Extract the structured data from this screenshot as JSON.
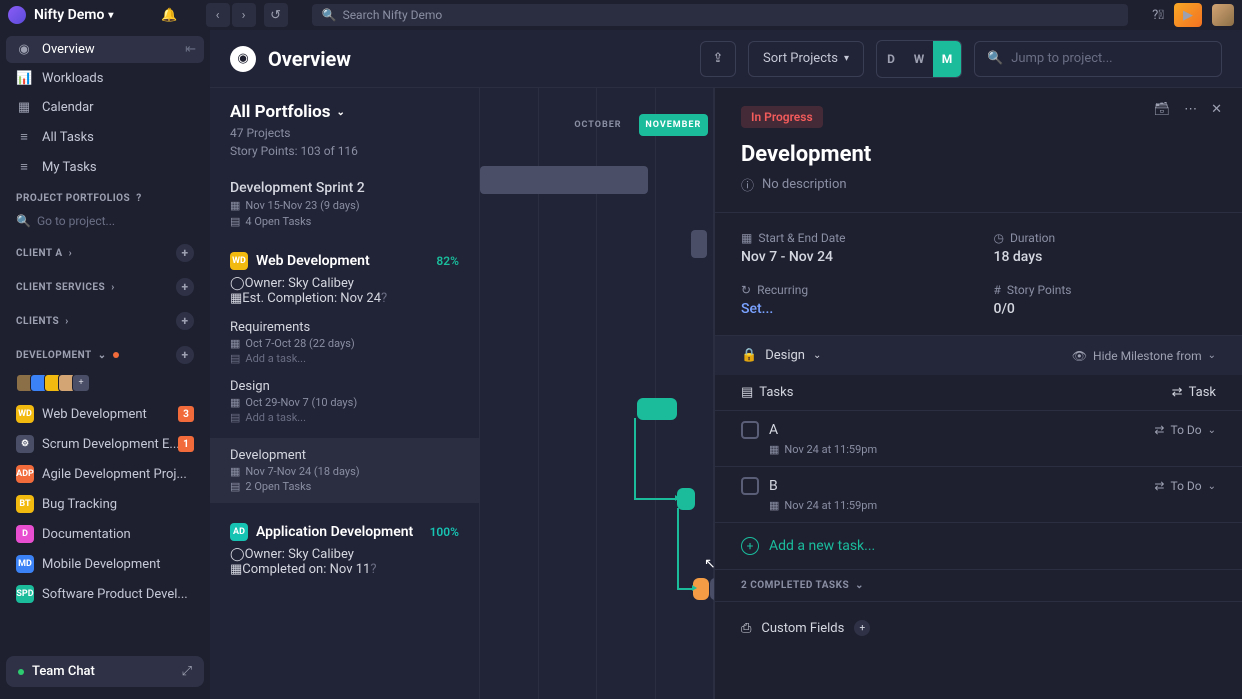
{
  "topbar": {
    "workspace": "Nifty Demo",
    "search_placeholder": "Search Nifty Demo"
  },
  "sidebar": {
    "nav": [
      {
        "icon": "◉",
        "label": "Overview",
        "active": true
      },
      {
        "icon": "⫿",
        "label": "Workloads"
      },
      {
        "icon": "▦",
        "label": "Calendar"
      },
      {
        "icon": "≡",
        "label": "All Tasks"
      },
      {
        "icon": "≡",
        "label": "My Tasks"
      }
    ],
    "portfolios_header": "PROJECT PORTFOLIOS",
    "goto_placeholder": "Go to project...",
    "sections": [
      {
        "name": "CLIENT A"
      },
      {
        "name": "CLIENT SERVICES"
      },
      {
        "name": "CLIENTS"
      }
    ],
    "dev_section": "DEVELOPMENT",
    "dev_projects": [
      {
        "badge": "WD",
        "color": "#f2b90f",
        "name": "Web Development",
        "count": "3"
      },
      {
        "badge": "⚙",
        "color": "#4a4e66",
        "name": "Scrum Development E...",
        "count": "1"
      },
      {
        "badge": "ADP",
        "color": "#f26b3a",
        "name": "Agile Development Proj..."
      },
      {
        "badge": "BT",
        "color": "#f2b90f",
        "name": "Bug Tracking"
      },
      {
        "badge": "D",
        "color": "#e84fd0",
        "name": "Documentation"
      },
      {
        "badge": "MD",
        "color": "#3b82f6",
        "name": "Mobile Development"
      },
      {
        "badge": "SPD",
        "color": "#1abc9c",
        "name": "Software Product Devel..."
      }
    ],
    "chat": "Team Chat"
  },
  "overview": {
    "title": "Overview",
    "sort": "Sort Projects",
    "jump_placeholder": "Jump to project...",
    "modes": [
      "D",
      "W",
      "M"
    ]
  },
  "portfolio": {
    "title": "All Portfolios",
    "projects": "47 Projects",
    "points": "Story Points: 103 of 116"
  },
  "months": [
    "OCTOBER",
    "NOVEMBER"
  ],
  "groups": [
    {
      "type": "sprint",
      "title": "Development Sprint 2",
      "date": "Nov 15-Nov 23 (9 days)",
      "open": "4 Open Tasks"
    },
    {
      "type": "project",
      "title": "Web Development",
      "badge": "WD",
      "badge_color": "#f2b90f",
      "pct": "82%",
      "owner": "Owner: Sky Calibey",
      "completion": "Est. Completion: Nov 24",
      "milestones": [
        {
          "name": "Requirements",
          "date": "Oct 7-Oct 28 (22 days)",
          "add": "Add a task..."
        },
        {
          "name": "Design",
          "date": "Oct 29-Nov 7 (10 days)",
          "add": "Add a task..."
        },
        {
          "name": "Development",
          "date": "Nov 7-Nov 24 (18 days)",
          "open": "2 Open Tasks",
          "selected": true
        }
      ]
    },
    {
      "type": "project",
      "title": "Application Development",
      "badge": "AD",
      "badge_color": "#17c3b2",
      "pct": "100%",
      "owner": "Owner: Sky Calibey",
      "completion": "Completed on: Nov 11"
    }
  ],
  "detail": {
    "status": "In Progress",
    "title": "Development",
    "desc": "No description",
    "start_end_label": "Start & End Date",
    "start_end": "Nov 7 - Nov 24",
    "duration_label": "Duration",
    "duration": "18 days",
    "recurring_label": "Recurring",
    "recurring": "Set...",
    "points_label": "Story Points",
    "points": "0/0",
    "section": "Design",
    "hide": "Hide Milestone from",
    "tasks_header": "Tasks",
    "task_btn": "Task",
    "tasks": [
      {
        "name": "A",
        "due": "Nov 24 at 11:59pm",
        "status": "To Do"
      },
      {
        "name": "B",
        "due": "Nov 24 at 11:59pm",
        "status": "To Do"
      }
    ],
    "add_task": "Add a new task...",
    "completed": "2 COMPLETED TASKS",
    "custom_fields": "Custom Fields"
  }
}
